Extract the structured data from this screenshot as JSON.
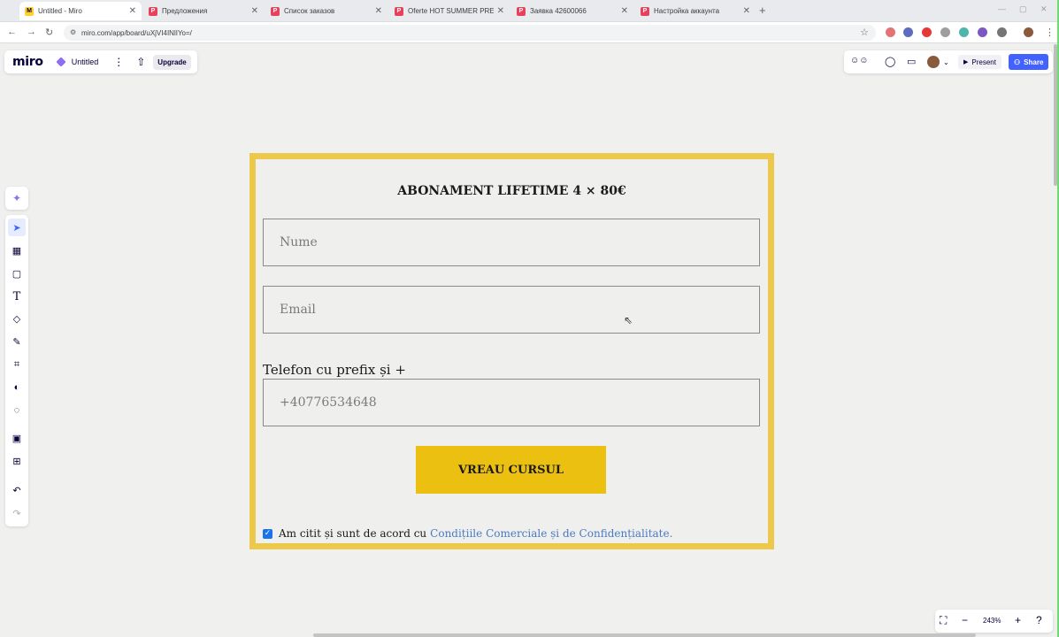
{
  "browser": {
    "tabs": [
      {
        "title": "Untitled - Miro",
        "favicon": "miro-favicon"
      },
      {
        "title": "Предложения",
        "favicon": "red-favicon"
      },
      {
        "title": "Список заказов",
        "favicon": "red-favicon"
      },
      {
        "title": "Oferte HOT SUMMER PRE-SAL",
        "favicon": "red-favicon"
      },
      {
        "title": "Заявка 42600066",
        "favicon": "red-favicon"
      },
      {
        "title": "Настройка аккаунта",
        "favicon": "red-favicon"
      }
    ],
    "url": "miro.com/app/board/uXjVI4INlIYo=/"
  },
  "miro": {
    "logo": "miro",
    "board_name": "Untitled",
    "upgrade_label": "Upgrade",
    "present_label": "Present",
    "share_label": "Share",
    "zoom": "243%",
    "accent_color": "#4262ff"
  },
  "form": {
    "title": "ABONAMENT LIFETIME 4 × 80€",
    "name_placeholder": "Nume",
    "email_placeholder": "Email",
    "phone_label": "Telefon cu prefix și +",
    "phone_placeholder": "+40776534648",
    "submit_label": "VREAU CURSUL",
    "consent_text": "Am citit și sunt de acord cu",
    "consent_link": "Condițiile Comerciale și de Confidențialitate.",
    "consent_checked": true,
    "border_color": "#ecc94b",
    "button_color": "#ecc010"
  }
}
